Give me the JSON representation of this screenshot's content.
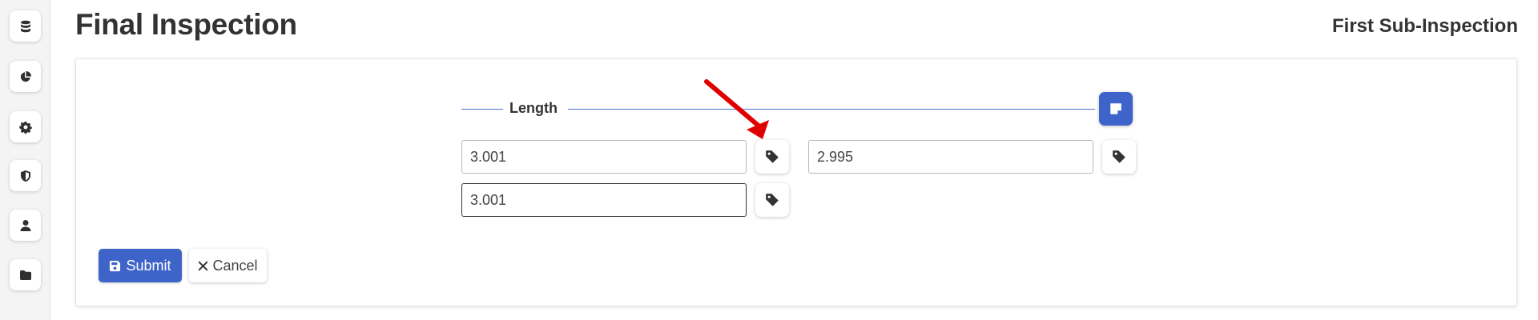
{
  "page": {
    "title": "Final Inspection",
    "subtitle": "First Sub-Inspection"
  },
  "sidebar": {
    "items": [
      {
        "icon": "database-icon"
      },
      {
        "icon": "pie-chart-icon"
      },
      {
        "icon": "gear-icon"
      },
      {
        "icon": "shield-icon"
      },
      {
        "icon": "user-icon"
      },
      {
        "icon": "folder-icon"
      }
    ]
  },
  "form": {
    "section_label": "Length",
    "note_icon": "sticky-note-icon",
    "measurements": [
      {
        "value": "3.001"
      },
      {
        "value": "2.995"
      },
      {
        "value": "3.001"
      }
    ],
    "tag_icon": "tag-icon"
  },
  "actions": {
    "submit_label": "Submit",
    "cancel_label": "Cancel"
  },
  "colors": {
    "accent": "#3f64c9",
    "annotation_arrow": "#e00000"
  }
}
